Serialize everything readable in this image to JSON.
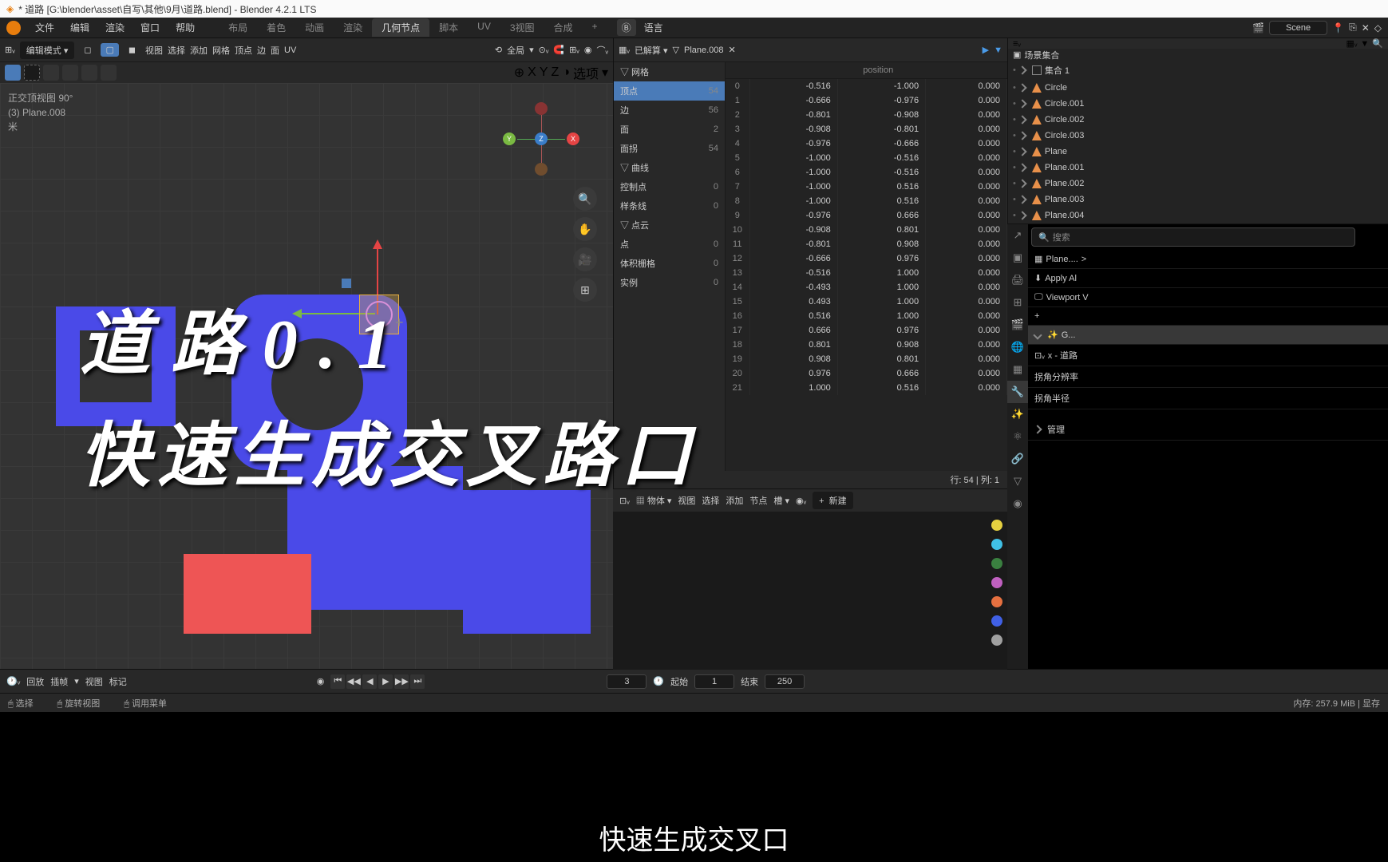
{
  "titlebar": "* 道路 [G:\\blender\\asset\\自写\\其他\\9月\\道路.blend] - Blender 4.2.1 LTS",
  "menuTop": [
    "文件",
    "编辑",
    "渲染",
    "窗口",
    "帮助"
  ],
  "workspaces": [
    "布局",
    "着色",
    "动画",
    "渲染",
    "几何节点",
    "脚本",
    "UV",
    "3视图",
    "合成",
    "+"
  ],
  "activeWorkspace": "几何节点",
  "languageBtn": "语言",
  "sceneLabel": "Scene",
  "viewport": {
    "mode": "编辑模式",
    "menus": [
      "视图",
      "选择",
      "添加",
      "网格",
      "顶点",
      "边",
      "面",
      "UV"
    ],
    "orient": "全局",
    "axisLabels": [
      "X",
      "Y",
      "Z"
    ],
    "options": "选项",
    "info1": "正交顶视图 90°",
    "info2": "(3) Plane.008",
    "info3": "米"
  },
  "overlayText1": "道路0.1",
  "overlayText2": "快速生成交叉路口",
  "spreadsheetHeader": {
    "dropdown": "已解算",
    "object": "Plane.008"
  },
  "spreadsheetCol": "position",
  "treeItems": [
    {
      "label": "▽ 网格",
      "count": ""
    },
    {
      "label": "    顶点",
      "count": "54",
      "sel": true
    },
    {
      "label": "    边",
      "count": "56"
    },
    {
      "label": "    面",
      "count": "2"
    },
    {
      "label": "    面拐",
      "count": "54"
    },
    {
      "label": "▽ 曲线",
      "count": ""
    },
    {
      "label": "    控制点",
      "count": "0"
    },
    {
      "label": "    样条线",
      "count": "0"
    },
    {
      "label": "▽ 点云",
      "count": ""
    },
    {
      "label": "    点",
      "count": "0"
    },
    {
      "label": "  体积栅格",
      "count": "0"
    },
    {
      "label": "  实例",
      "count": "0"
    }
  ],
  "tableRows": [
    [
      0,
      "-0.516",
      "-1.000",
      "0.000"
    ],
    [
      1,
      "-0.666",
      "-0.976",
      "0.000"
    ],
    [
      2,
      "-0.801",
      "-0.908",
      "0.000"
    ],
    [
      3,
      "-0.908",
      "-0.801",
      "0.000"
    ],
    [
      4,
      "-0.976",
      "-0.666",
      "0.000"
    ],
    [
      5,
      "-1.000",
      "-0.516",
      "0.000"
    ],
    [
      6,
      "-1.000",
      "-0.516",
      "0.000"
    ],
    [
      7,
      "-1.000",
      "0.516",
      "0.000"
    ],
    [
      8,
      "-1.000",
      "0.516",
      "0.000"
    ],
    [
      9,
      "-0.976",
      "0.666",
      "0.000"
    ],
    [
      10,
      "-0.908",
      "0.801",
      "0.000"
    ],
    [
      11,
      "-0.801",
      "0.908",
      "0.000"
    ],
    [
      12,
      "-0.666",
      "0.976",
      "0.000"
    ],
    [
      13,
      "-0.516",
      "1.000",
      "0.000"
    ],
    [
      14,
      "-0.493",
      "1.000",
      "0.000"
    ],
    [
      15,
      "0.493",
      "1.000",
      "0.000"
    ],
    [
      16,
      "0.516",
      "1.000",
      "0.000"
    ],
    [
      17,
      "0.666",
      "0.976",
      "0.000"
    ],
    [
      18,
      "0.801",
      "0.908",
      "0.000"
    ],
    [
      19,
      "0.908",
      "0.801",
      "0.000"
    ],
    [
      20,
      "0.976",
      "0.666",
      "0.000"
    ],
    [
      21,
      "1.000",
      "0.516",
      "0.000"
    ]
  ],
  "spreadsheetFooter": "行: 54 | 列: 1",
  "nodeEditor": {
    "mode": "物体",
    "menus": [
      "视图",
      "选择",
      "添加",
      "节点"
    ],
    "slot": "槽",
    "new": "新建"
  },
  "outliner": {
    "header": "场景集合",
    "items": [
      "集合 1",
      "Circle",
      "Circle.001",
      "Circle.002",
      "Circle.003",
      "Plane",
      "Plane.001",
      "Plane.002",
      "Plane.003",
      "Plane.004"
    ],
    "searchPlaceholder": "搜索"
  },
  "props": {
    "objName": "Plane....",
    "items": [
      "Apply Al",
      "Viewport V"
    ],
    "geoLabel": "G...",
    "modLabel": "x - 道路",
    "param1": "拐角分辨率",
    "param2": "拐角半径",
    "manage": "管理"
  },
  "timeline": {
    "menus": [
      "回放",
      "插帧",
      "视图",
      "标记"
    ],
    "current": "3",
    "startLabel": "起始",
    "start": "1",
    "endLabel": "结束",
    "end": "250"
  },
  "statusbar": {
    "select": "选择",
    "rotate": "旋转视图",
    "menu": "调用菜单",
    "mem": "内存: 257.9 MiB | 显存"
  },
  "subtitle": "快速生成交叉口"
}
